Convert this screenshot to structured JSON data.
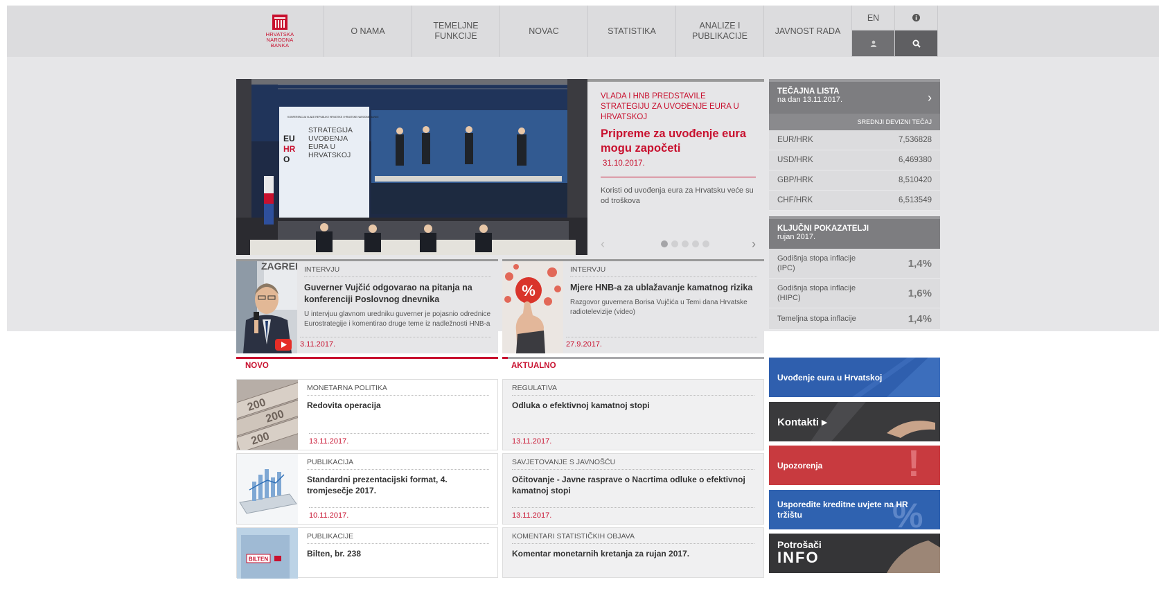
{
  "logo": {
    "line1": "HRVATSKA",
    "line2": "NARODNA",
    "line3": "BANKA"
  },
  "nav": {
    "items": [
      "O NAMA",
      "TEMELJNE\nFUNKCIJE",
      "NOVAC",
      "STATISTIKA",
      "ANALIZE I\nPUBLIKACIJE",
      "JAVNOST RADA"
    ],
    "lang": "EN",
    "icons": [
      "info-icon",
      "user-icon",
      "search-icon"
    ]
  },
  "hero": {
    "kicker": "VLADA I HNB PREDSTAVILE STRATEGIJU ZA UVOĐENJE EURA U HRVATSKOJ",
    "title": "Pripreme za uvođenje eura mogu započeti",
    "date": "31.10.2017.",
    "desc": "Koristi od uvođenja eura za Hrvatsku veće su od troškova",
    "slide_count": 5,
    "active_slide": 1,
    "screen_text": {
      "small": "KONFERENCIJA VLADE REPUBLIKE HRVATSKE I HRVATSKE NARODNE BANKE",
      "eu": "EU",
      "hr": "HR",
      "o": "O",
      "strategy": "STRATEGIJA UVOĐENJA EURA U HRVATSKOJ"
    }
  },
  "rates": {
    "title": "TEČAJNA LISTA",
    "subtitle": "na dan  13.11.2017.",
    "column": "SREDNJI DEVIZNI TEČAJ",
    "rows": [
      {
        "pair": "EUR/HRK",
        "value": "7,536828"
      },
      {
        "pair": "USD/HRK",
        "value": "6,469380"
      },
      {
        "pair": "GBP/HRK",
        "value": "8,510420"
      },
      {
        "pair": "CHF/HRK",
        "value": "6,513549"
      }
    ]
  },
  "indicators": {
    "title": "KLJUČNI POKAZATELJI",
    "subtitle": "rujan 2017.",
    "rows": [
      {
        "label": "Godišnja stopa inflacije (IPC)",
        "value": "1,4%"
      },
      {
        "label": "Godišnja stopa inflacije (HIPC)",
        "value": "1,6%"
      },
      {
        "label": "Temeljna stopa inflacije",
        "value": "1,4%"
      }
    ]
  },
  "cards": [
    {
      "cat": "INTERVJU",
      "title": "Guverner Vujčić odgovarao na pitanja na konferenciji Poslovnog dnevnika",
      "desc": "U intervjuu glavnom uredniku guverner je pojasnio odrednice Eurostrategije i komentirao druge teme iz nadležnosti HNB-a",
      "date": "3.11.2017.",
      "bg_text": "ZAGREB ANCI DIST"
    },
    {
      "cat": "INTERVJU",
      "title": "Mjere HNB-a za ublažavanje kamatnog rizika",
      "desc": "Razgovor guvernera Borisa Vujčića u Temi dana Hrvatske radiotelevizije (video)",
      "date": "27.9.2017.",
      "badge": "%"
    }
  ],
  "sections": {
    "novo": "NOVO",
    "aktualno": "AKTUALNO"
  },
  "novo": [
    {
      "cat": "MONETARNA POLITIKA",
      "title": "Redovita operacija",
      "date": "13.11.2017."
    },
    {
      "cat": "PUBLIKACIJA",
      "title": "Standardni prezentacijski format, 4. tromjesečje 2017.",
      "date": "10.11.2017."
    },
    {
      "cat": "PUBLIKACIJE",
      "title": "Bilten, br. 238",
      "date": "",
      "badge": "BILTEN"
    }
  ],
  "aktualno": [
    {
      "cat": "REGULATIVA",
      "title": "Odluka o efektivnoj kamatnoj stopi",
      "date": "13.11.2017."
    },
    {
      "cat": "SAVJETOVANJE S JAVNOŠĆU",
      "title": "Očitovanje - Javne rasprave o Nacrtima odluke o efektivnoj kamatnoj stopi",
      "date": "13.11.2017."
    },
    {
      "cat": "KOMENTARI STATISTIČKIH OBJAVA",
      "title": "Komentar monetarnih kretanja za rujan 2017.",
      "date": ""
    }
  ],
  "banners": [
    {
      "label": "Uvođenje eura u Hrvatskoj",
      "color": "#2f5fae"
    },
    {
      "label": "Kontakti ▸",
      "color": "#3a3a3c"
    },
    {
      "label": "Upozorenja",
      "color": "#c83a3f"
    },
    {
      "label": "Usporedite kreditne uvjete na HR tržištu",
      "color": "#2f62b0"
    },
    {
      "label": "Potrošači",
      "label2": "INFO",
      "color": "#353537"
    }
  ]
}
